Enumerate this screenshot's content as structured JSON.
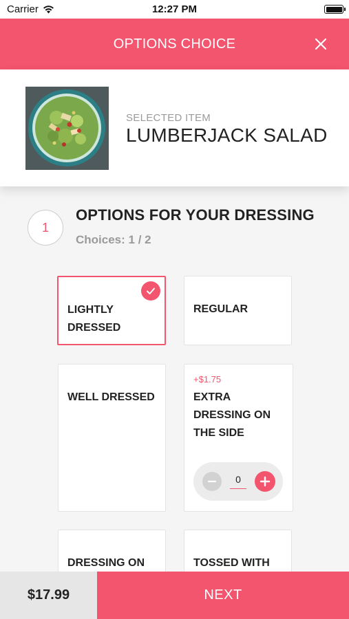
{
  "status_bar": {
    "carrier": "Carrier",
    "time": "12:27 PM"
  },
  "nav": {
    "title": "OPTIONS CHOICE",
    "close_icon": "close-icon"
  },
  "item": {
    "selected_label": "SELECTED ITEM",
    "name": "LUMBERJACK SALAD",
    "image_icon": "salad-photo"
  },
  "section": {
    "step_number": "1",
    "title": "OPTIONS FOR YOUR DRESSING",
    "choices": "Choices: 1 / 2"
  },
  "options": [
    {
      "label": "LIGHTLY DRESSED",
      "selected": true
    },
    {
      "label": "REGULAR",
      "selected": false
    },
    {
      "label": "WELL DRESSED",
      "selected": false
    },
    {
      "label": "EXTRA DRESSING ON THE SIDE",
      "price": "+$1.75",
      "quantity": "0",
      "selected": false
    },
    {
      "label": "DRESSING ON",
      "selected": false
    },
    {
      "label": "TOSSED WITH",
      "selected": false
    }
  ],
  "footer": {
    "total": "$17.99",
    "next_label": "NEXT"
  },
  "colors": {
    "accent": "#f3546e",
    "muted_text": "#9a9a9a",
    "footer_bg": "#e6e6e6"
  }
}
